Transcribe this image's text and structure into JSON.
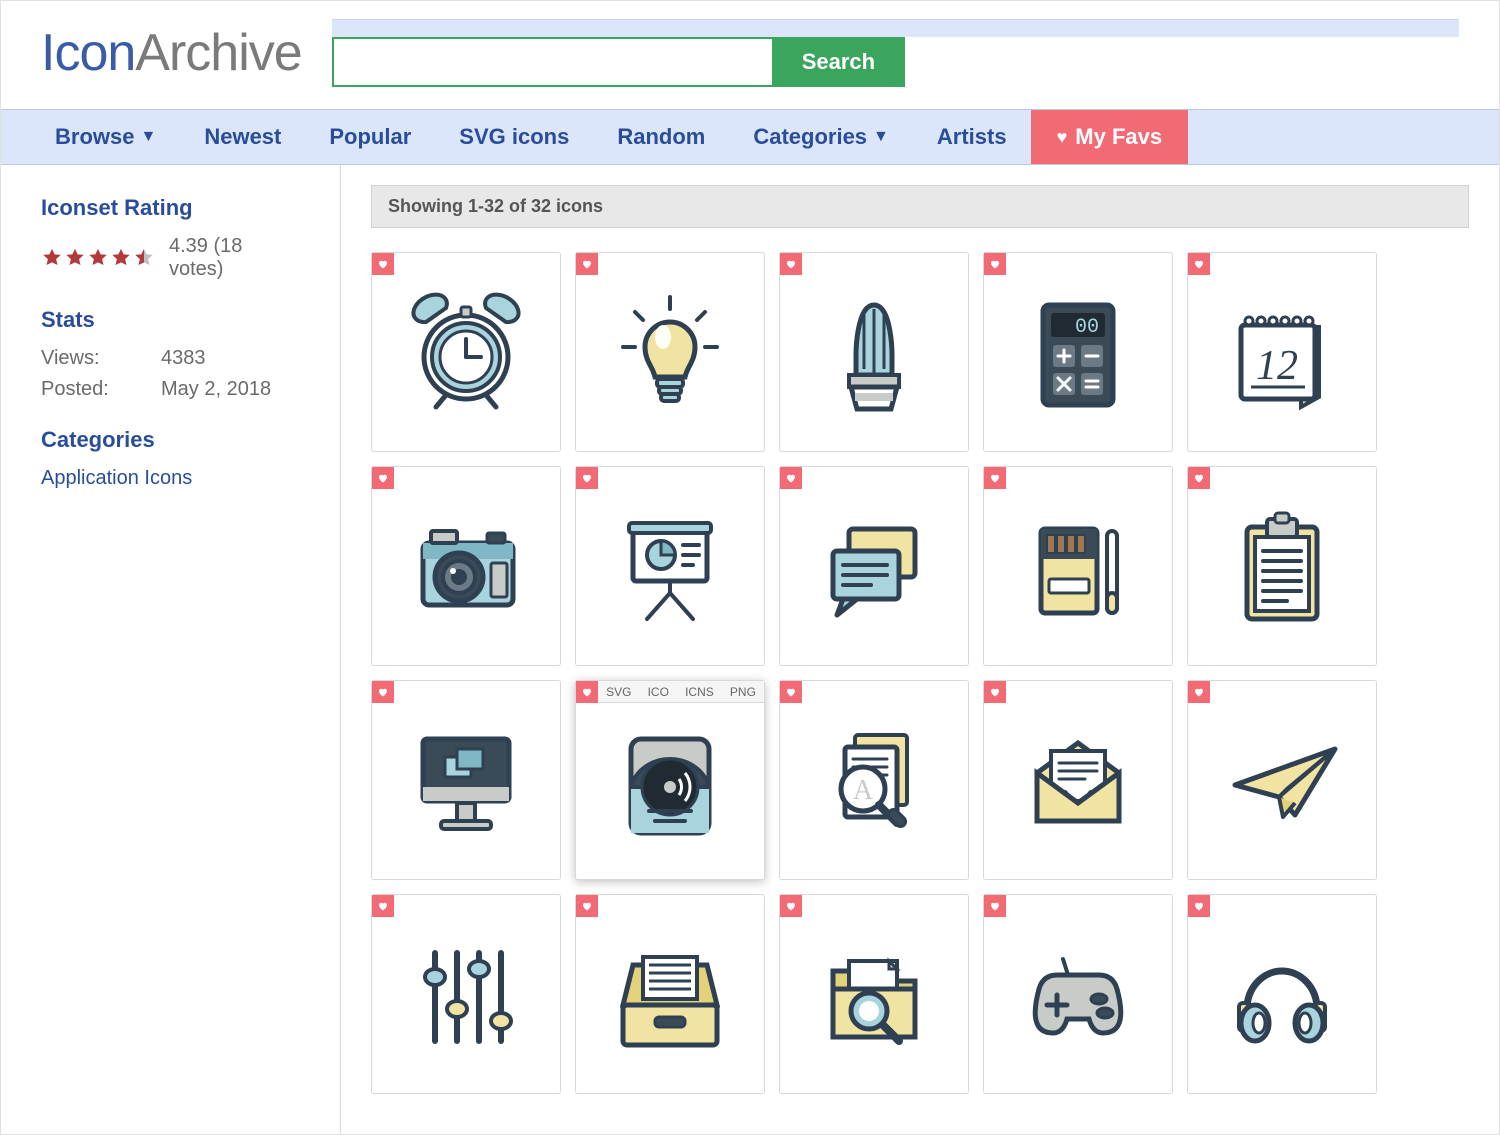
{
  "logo": {
    "part1": "Icon",
    "part2": "Archive"
  },
  "search": {
    "placeholder": "",
    "button": "Search"
  },
  "nav": {
    "browse": "Browse",
    "newest": "Newest",
    "popular": "Popular",
    "svg": "SVG icons",
    "random": "Random",
    "categories": "Categories",
    "artists": "Artists",
    "favs": "My Favs"
  },
  "sidebar": {
    "rating_title": "Iconset Rating",
    "rating_value": "4.39",
    "rating_votes": "(18 votes)",
    "stats_title": "Stats",
    "views_label": "Views:",
    "views_value": "4383",
    "posted_label": "Posted:",
    "posted_value": "May 2, 2018",
    "categories_title": "Categories",
    "category_link": "Application Icons"
  },
  "count_text": "Showing 1-32 of 32 icons",
  "formats": [
    "SVG",
    "ICO",
    "ICNS",
    "PNG"
  ],
  "icons": [
    {
      "name": "alarm-clock"
    },
    {
      "name": "lightbulb"
    },
    {
      "name": "cactus"
    },
    {
      "name": "calculator"
    },
    {
      "name": "calendar"
    },
    {
      "name": "camera"
    },
    {
      "name": "presentation-chart"
    },
    {
      "name": "chat-bubbles"
    },
    {
      "name": "cigarette-pack"
    },
    {
      "name": "clipboard"
    },
    {
      "name": "computer-monitor"
    },
    {
      "name": "disk-drive",
      "hover": true
    },
    {
      "name": "document-search"
    },
    {
      "name": "email-envelope"
    },
    {
      "name": "paper-plane"
    },
    {
      "name": "equalizer-sliders"
    },
    {
      "name": "file-drawer"
    },
    {
      "name": "folder-search"
    },
    {
      "name": "gamepad"
    },
    {
      "name": "headphones"
    }
  ],
  "palette": {
    "stroke": "#2e4052",
    "blue": "#a9d3dd",
    "blue2": "#7fb8c4",
    "yellow": "#f1e4a2",
    "yellow2": "#e3d27a",
    "dark": "#3a4a57",
    "gray": "#c8ccc9",
    "white": "#ffffff"
  },
  "calendar_number": "12"
}
